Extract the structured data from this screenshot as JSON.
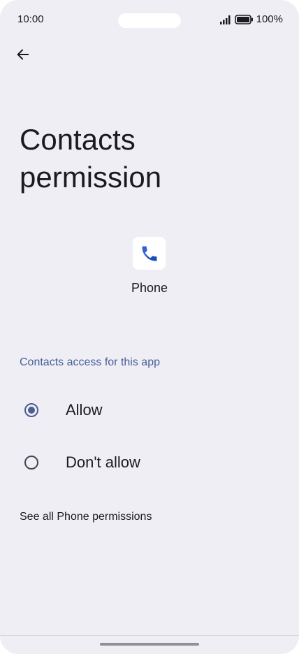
{
  "status_bar": {
    "time": "10:00",
    "battery": "100%",
    "icons": [
      "signal-icon",
      "battery-icon"
    ]
  },
  "header": {
    "back_icon": "arrow-back-icon",
    "title": "Contacts permission"
  },
  "app": {
    "icon": "phone-app-icon",
    "name": "Phone"
  },
  "permission": {
    "section_label": "Contacts access for this app",
    "options": [
      {
        "label": "Allow",
        "selected": true
      },
      {
        "label": "Don't allow",
        "selected": false
      }
    ]
  },
  "links": {
    "see_all": "See all Phone permissions"
  },
  "colors": {
    "background": "#efeef4",
    "accent": "#4f5d95",
    "section_label": "#47609a"
  }
}
